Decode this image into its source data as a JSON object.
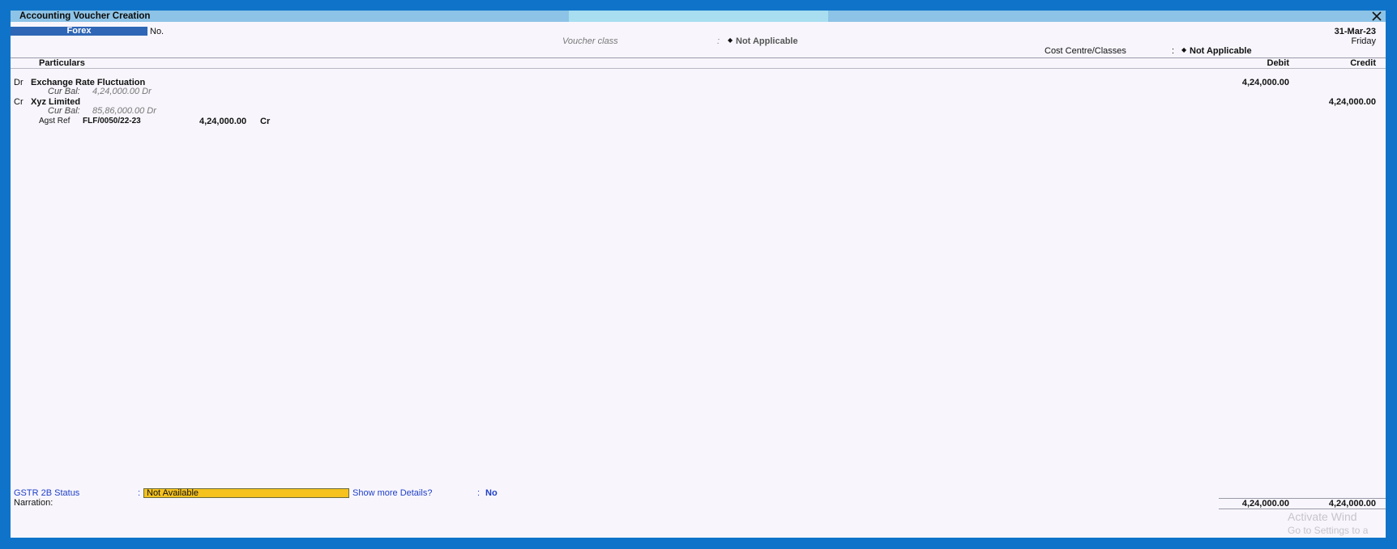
{
  "window": {
    "title": "Accounting Voucher Creation"
  },
  "header": {
    "voucher_type": "Forex",
    "no_label": "No.",
    "date": "31-Mar-23",
    "day": "Friday",
    "voucher_class_label": "Voucher class",
    "voucher_class_sep": ":",
    "voucher_class_value": "Not Applicable",
    "cost_centre_label": "Cost Centre/Classes",
    "cost_centre_sep": ":",
    "cost_centre_value": "Not Applicable",
    "diamond": "◆"
  },
  "columns": {
    "particulars": "Particulars",
    "debit": "Debit",
    "credit": "Credit"
  },
  "entries": [
    {
      "type": "Dr",
      "ledger": "Exchange Rate Fluctuation",
      "cur_bal_label": "Cur Bal:",
      "cur_bal_value": "4,24,000.00 Dr",
      "debit": "4,24,000.00",
      "credit": ""
    },
    {
      "type": "Cr",
      "ledger": "Xyz Limited",
      "cur_bal_label": "Cur Bal:",
      "cur_bal_value": "85,86,000.00 Dr",
      "debit": "",
      "credit": "4,24,000.00",
      "bill_ref": {
        "method": "Agst Ref",
        "name": "FLF/0050/22-23",
        "amount": "4,24,000.00",
        "drcr": "Cr"
      }
    }
  ],
  "footer": {
    "gstr_label": "GSTR 2B Status",
    "gstr_sep": ":",
    "gstr_value": "Not Available",
    "show_more_label": "Show more Details?",
    "show_more_sep": ":",
    "show_more_value": "No",
    "narration_label": "Narration:",
    "total_debit": "4,24,000.00",
    "total_credit": "4,24,000.00"
  },
  "watermark": {
    "line1": "Activate Wind",
    "line2": "Go to Settings to a"
  }
}
